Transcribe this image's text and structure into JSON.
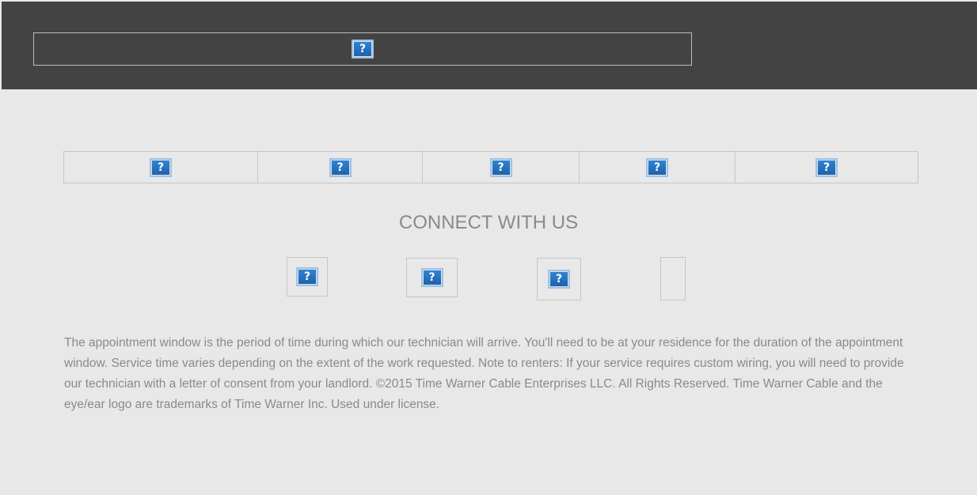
{
  "header": {
    "banner_image": "broken-image-icon"
  },
  "nav": {
    "items": [
      {
        "icon": "broken-image-icon"
      },
      {
        "icon": "broken-image-icon"
      },
      {
        "icon": "broken-image-icon"
      },
      {
        "icon": "broken-image-icon"
      },
      {
        "icon": "broken-image-icon"
      }
    ]
  },
  "connect": {
    "title": "CONNECT WITH US",
    "links": [
      {
        "icon": "broken-image-icon"
      },
      {
        "icon": "broken-image-icon"
      },
      {
        "icon": "broken-image-icon"
      },
      {
        "icon": "empty-image"
      }
    ]
  },
  "broken_glyph": "?",
  "footer": {
    "legal_text": "The appointment window is the period of time during which our technician will arrive. You'll need to be at your residence for the duration of the appointment window. Service time varies depending on the extent of the work requested. Note to renters: If your service requires custom wiring, you will need to provide our technician with a letter of consent from your landlord. ©2015 Time Warner Cable Enterprises LLC. All Rights Reserved. Time Warner Cable and the eye/ear logo are trademarks of Time Warner Inc. Used under license."
  },
  "colors": {
    "header_bg": "#434343",
    "page_bg": "#e8e8e8",
    "text_gray": "#8a8a8a",
    "border": "#c6c6c6"
  }
}
